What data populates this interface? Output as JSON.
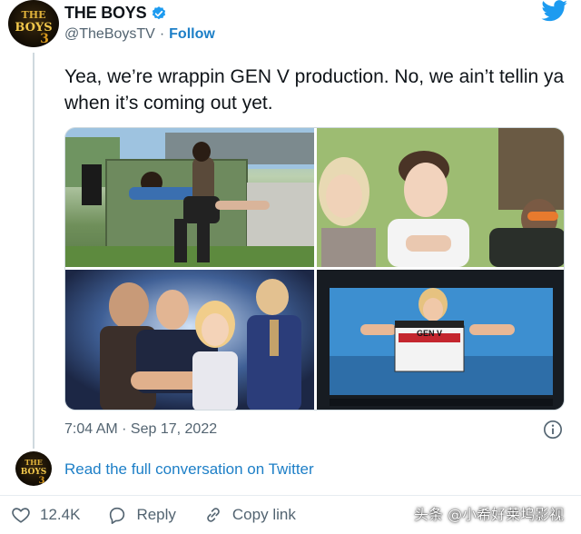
{
  "account": {
    "name": "THE BOYS",
    "handle": "@TheBoysTV",
    "separator": "·",
    "follow_label": "Follow",
    "avatar_logo_text": "THE BOYS"
  },
  "tweet": {
    "text": "Yea, we’re wrappin GEN V production. No, we ain’t tellin ya when it’s coming out yet.",
    "time": "7:04 AM · Sep 17, 2022",
    "media": [
      {
        "name": "photo-cast-bench",
        "description_icon": "photo-icon"
      },
      {
        "name": "photo-cast-selfie",
        "description_icon": "photo-icon"
      },
      {
        "name": "photo-poster-supes",
        "description_icon": "photo-icon"
      },
      {
        "name": "photo-clapperboard",
        "description_icon": "photo-icon"
      }
    ],
    "clapper_title": "GEN V"
  },
  "conversation": {
    "read_full_label": "Read the full conversation on Twitter"
  },
  "actions": {
    "like_count": "12.4K",
    "reply_label": "Reply",
    "copy_link_label": "Copy link"
  },
  "watermark": {
    "text": "头条 @小希好莱坞影视"
  },
  "colors": {
    "accent": "#1d7fc7",
    "verified": "#1d9bf0",
    "muted": "#536471",
    "text": "#0f1419"
  }
}
